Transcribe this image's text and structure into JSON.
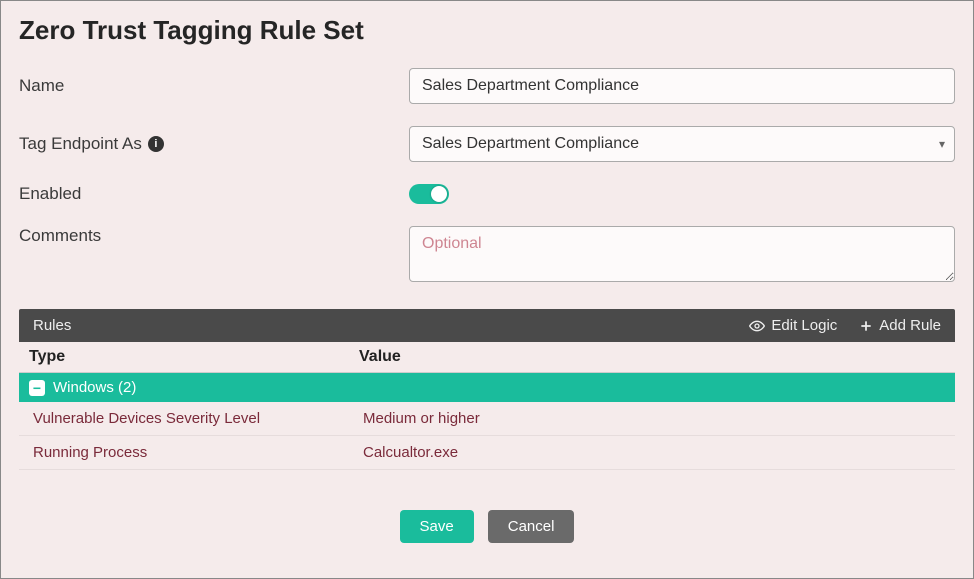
{
  "title": "Zero Trust Tagging Rule Set",
  "form": {
    "name_label": "Name",
    "name_value": "Sales Department Compliance",
    "tag_label": "Tag Endpoint As",
    "tag_value": "Sales Department Compliance",
    "enabled_label": "Enabled",
    "enabled_value": true,
    "comments_label": "Comments",
    "comments_placeholder": "Optional",
    "comments_value": ""
  },
  "rules_section": {
    "header_title": "Rules",
    "edit_logic_label": "Edit Logic",
    "add_rule_label": "Add Rule",
    "columns": {
      "type": "Type",
      "value": "Value"
    },
    "group": {
      "label": "Windows (2)",
      "expanded": true
    },
    "rows": [
      {
        "type": "Vulnerable Devices Severity Level",
        "value": "Medium or higher"
      },
      {
        "type": "Running Process",
        "value": "Calcualtor.exe"
      }
    ]
  },
  "buttons": {
    "save": "Save",
    "cancel": "Cancel"
  },
  "colors": {
    "accent": "#1abc9c",
    "header_bg": "#4a4a4a"
  }
}
